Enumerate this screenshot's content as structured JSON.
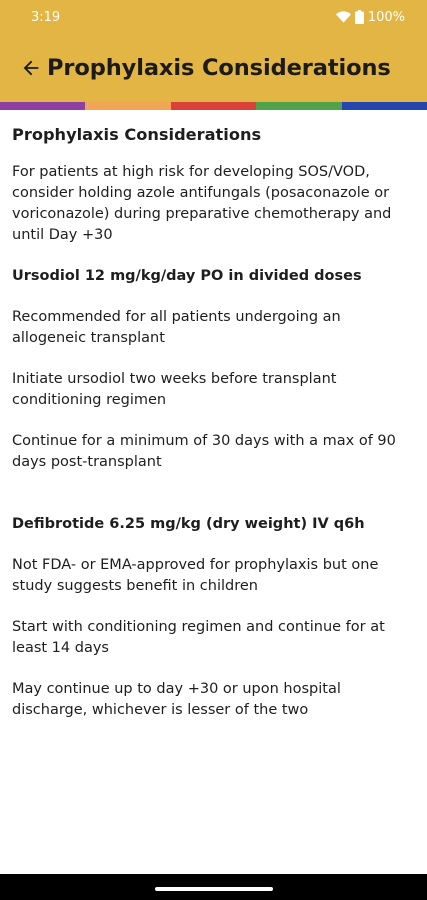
{
  "status_bar": {
    "time": "3:19",
    "battery": "100%"
  },
  "header": {
    "title": "Prophylaxis Considerations"
  },
  "stripe_colors": [
    "#8e3fa3",
    "#f0a654",
    "#d9413a",
    "#52a24c",
    "#2546b0"
  ],
  "content": {
    "heading": "Prophylaxis Considerations",
    "intro": "For patients at high risk for developing SOS/VOD, consider holding azole antifungals (posaconazole or voriconazole) during preparative chemotherapy and until Day +30",
    "ursodiol": {
      "title": "Ursodiol 12 mg/kg/day PO in divided doses",
      "items": [
        "Recommended for all patients undergoing an allogeneic transplant",
        "Initiate ursodiol two weeks before transplant conditioning regimen",
        "Continue for a minimum of 30 days with a max of 90 days post-transplant"
      ]
    },
    "defibrotide": {
      "title": "Defibrotide 6.25 mg/kg (dry weight) IV q6h",
      "items": [
        "Not FDA- or EMA-approved for prophylaxis but one study suggests benefit in children",
        "Start with conditioning regimen and continue for at least 14 days",
        "May continue up to day +30 or upon hospital discharge, whichever is lesser of the two"
      ]
    }
  }
}
